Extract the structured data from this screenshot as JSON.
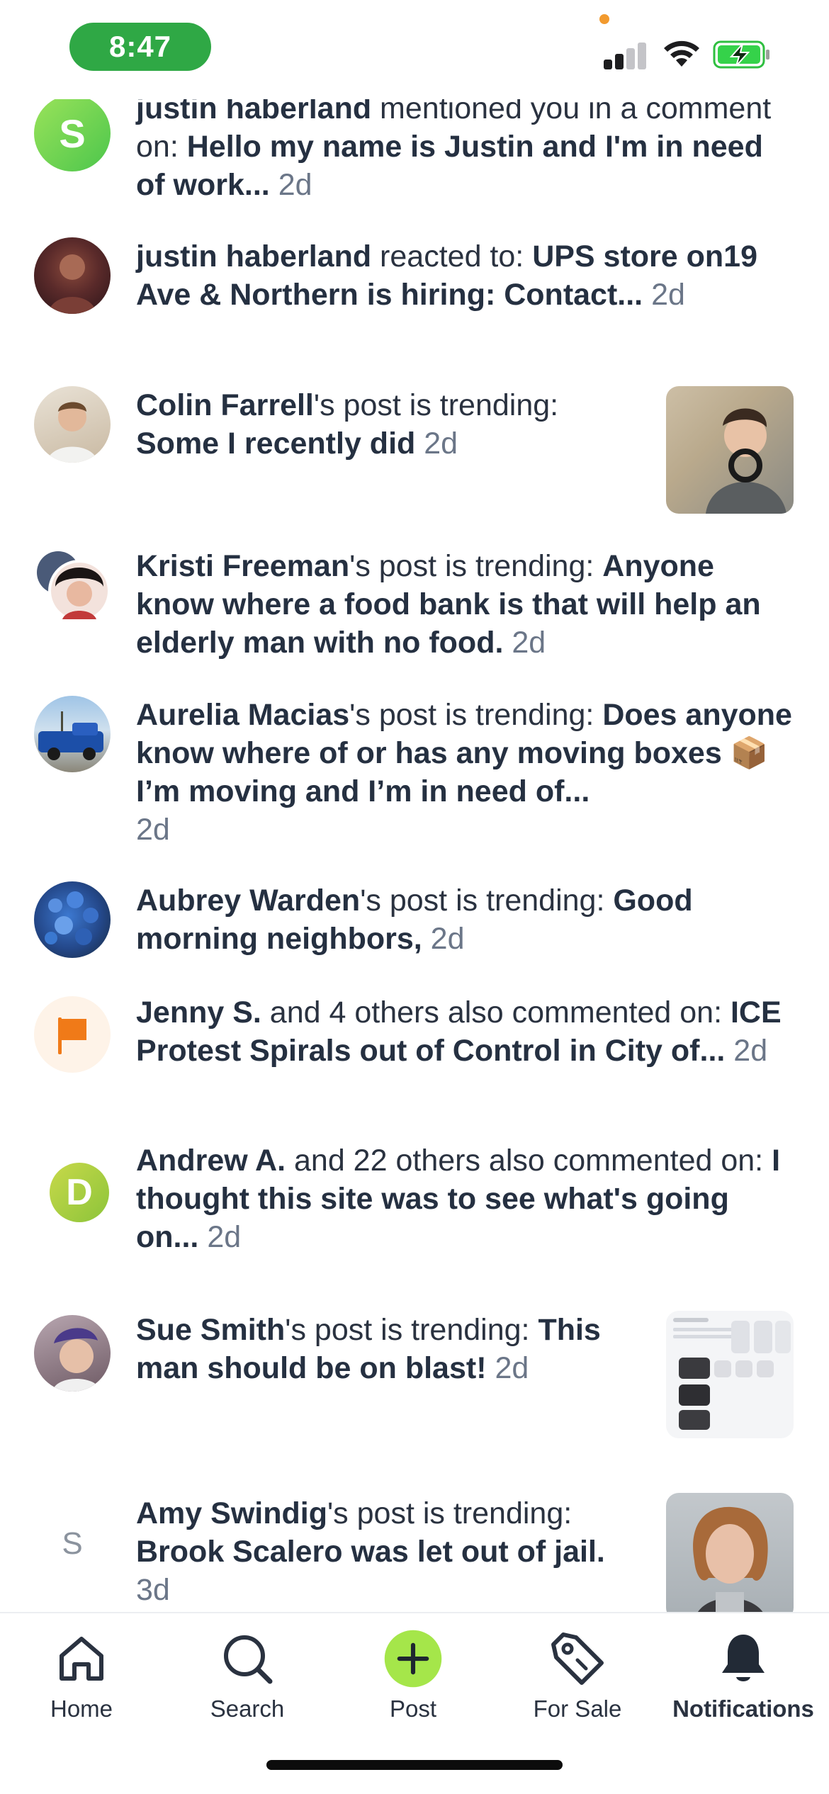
{
  "status_bar": {
    "time": "8:47",
    "time_pill_color": "#2fa845",
    "battery_state": "charging",
    "icons": [
      "signal-icon",
      "wifi-icon",
      "battery-charging-icon"
    ]
  },
  "notifications": [
    {
      "avatar": {
        "type": "letter",
        "letter": "S",
        "color": "#74d94e"
      },
      "actor": "justin haberland",
      "action": " mentioned you in a comment on: ",
      "subject": "Hello my name is Justin and I'm in need of work...",
      "age": "2d"
    },
    {
      "avatar": {
        "type": "photo",
        "icon": "person-photo"
      },
      "actor": "justin haberland",
      "action": " reacted to: ",
      "subject": "UPS store on19 Ave & Northern is hiring: Contact...",
      "age": "2d"
    },
    {
      "avatar": {
        "type": "photo",
        "icon": "person-photo"
      },
      "actor": "Colin Farrell",
      "action": "'s post is trending: ",
      "subject": "Some I recently did",
      "age": "2d",
      "thumbnail": "post-photo-thumbnail"
    },
    {
      "avatar": {
        "type": "photo",
        "icon": "person-photo"
      },
      "actor": "Kristi Freeman",
      "action": "'s post is trending: ",
      "subject": "Anyone know where a food bank is that will help an elderly man with no food.",
      "age": "2d"
    },
    {
      "avatar": {
        "type": "photo",
        "icon": "truck-photo"
      },
      "actor": "Aurelia Macias",
      "action": "'s post is trending: ",
      "subject": "Does anyone know where of or has any moving boxes 📦 I’m  moving and I’m in need of...",
      "age": "2d"
    },
    {
      "avatar": {
        "type": "photo",
        "icon": "flowers-photo"
      },
      "actor": "Aubrey Warden",
      "action": "'s post is trending: ",
      "subject": "Good morning neighbors,",
      "age": "2d"
    },
    {
      "avatar": {
        "type": "flag",
        "icon": "flag-icon",
        "color": "#f07a18"
      },
      "actor": "Jenny S.",
      "action": " and 4 others also commented on: ",
      "subject": "ICE Protest Spirals out of Control in City of...",
      "age": "2d"
    },
    {
      "avatar": {
        "type": "letter",
        "letter": "D",
        "color": "#a4c639"
      },
      "actor": "Andrew A.",
      "action": " and 22 others also commented on: ",
      "subject": "I thought this site was to see what's going on...",
      "age": "2d"
    },
    {
      "avatar": {
        "type": "photo",
        "icon": "person-photo"
      },
      "actor": "Sue Smith",
      "action": "'s post is trending: ",
      "subject": "This man should be on blast!",
      "age": "2d",
      "thumbnail": "screenshot-thumbnail"
    },
    {
      "avatar": {
        "type": "letter-plain",
        "letter": "S"
      },
      "actor": "Amy Swindig",
      "action": "'s post is trending: ",
      "subject": "Brook Scalero was let out of jail.",
      "age": "3d",
      "thumbnail": "mugshot-thumbnail"
    }
  ],
  "tab_bar": {
    "tabs": [
      {
        "label": "Home",
        "icon": "home-icon"
      },
      {
        "label": "Search",
        "icon": "search-icon"
      },
      {
        "label": "Post",
        "icon": "plus-icon",
        "accent": "#a5e64a"
      },
      {
        "label": "For Sale",
        "icon": "tag-icon"
      },
      {
        "label": "Notifications",
        "icon": "bell-icon",
        "active": true
      }
    ]
  }
}
